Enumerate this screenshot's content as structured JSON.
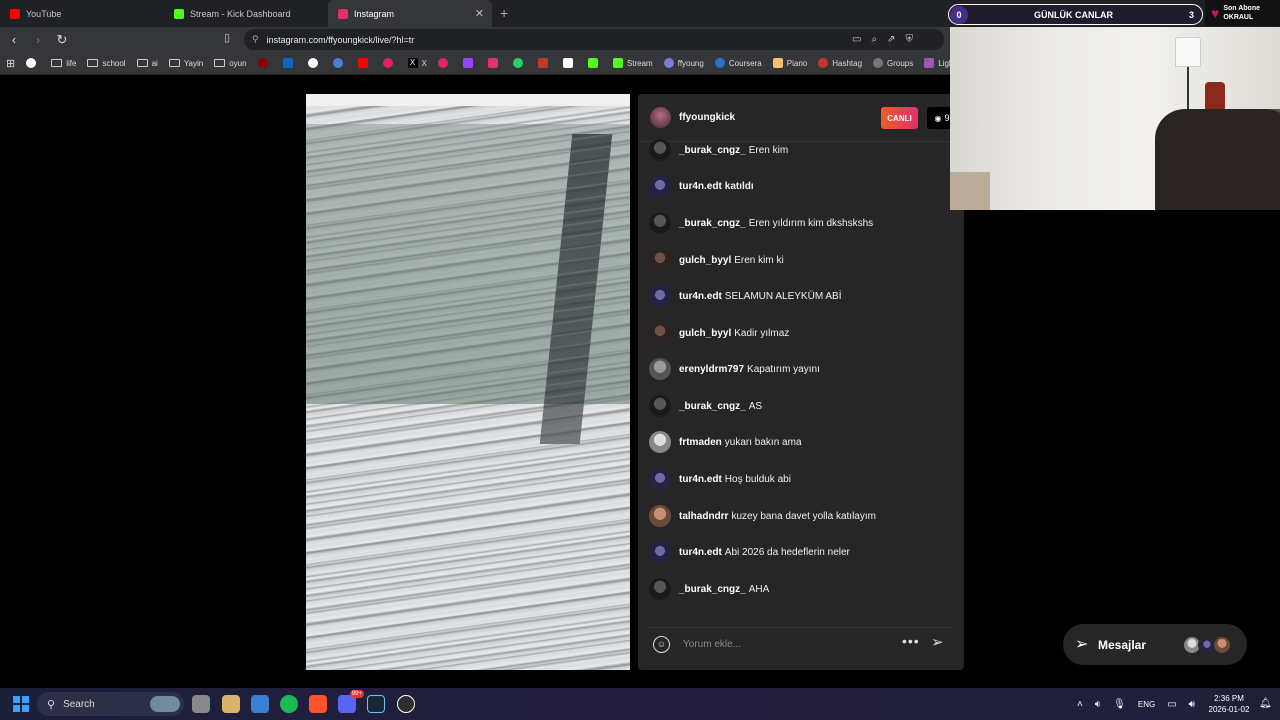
{
  "browser": {
    "tabs": [
      {
        "label": "YouTube",
        "color": "#ff0000"
      },
      {
        "label": "Stream - Kick Dashboard",
        "color": "#53fc18"
      },
      {
        "label": "Instagram",
        "color": "#e1306c"
      }
    ],
    "new_tab_glyph": "+",
    "url": "instagram.com/ffyoungkick/live/?hl=tr",
    "bookmarks": [
      {
        "label": "",
        "icon": "google-icon"
      },
      {
        "label": "life",
        "icon": "folder-icon"
      },
      {
        "label": "school",
        "icon": "folder-icon"
      },
      {
        "label": "ai",
        "icon": "folder-icon"
      },
      {
        "label": "Yayin",
        "icon": "folder-icon"
      },
      {
        "label": "oyun",
        "icon": "folder-icon"
      },
      {
        "label": "X",
        "icon": "x-icon"
      },
      {
        "label": "Stream",
        "icon": "kick-icon"
      },
      {
        "label": "ffyoung",
        "icon": "link-icon"
      },
      {
        "label": "Coursera",
        "icon": "coursera-icon"
      },
      {
        "label": "Piano",
        "icon": "piano-icon"
      },
      {
        "label": "Hashtag",
        "icon": "hashtag-icon"
      },
      {
        "label": "Groups",
        "icon": "groups-icon"
      },
      {
        "label": "Lightshot",
        "icon": "lightshot-icon"
      }
    ]
  },
  "live": {
    "host": "ffyoungkick",
    "live_label": "CANLI",
    "viewer_count": "9",
    "comments": [
      {
        "user": "_burak_cngz_",
        "text": "Eren kim",
        "avatar": "dark"
      },
      {
        "user": "tur4n.edt",
        "text": "katıldı",
        "avatar": "blue"
      },
      {
        "user": "_burak_cngz_",
        "text": "Eren yıldırım kim dkshskshs",
        "avatar": "dark"
      },
      {
        "user": "gulch_byyl",
        "text": "Eren kim ki",
        "avatar": "girl"
      },
      {
        "user": "tur4n.edt",
        "text": "SELAMUN ALEYKÜM ABİ",
        "avatar": "blue"
      },
      {
        "user": "gulch_byyl",
        "text": "Kadir yılmaz",
        "avatar": "girl"
      },
      {
        "user": "erenyldrm797",
        "text": "Kapatırım yayını",
        "avatar": "gray"
      },
      {
        "user": "_burak_cngz_",
        "text": "AS",
        "avatar": "dark"
      },
      {
        "user": "frtmaden",
        "text": "yukarı bakın ama",
        "avatar": "light"
      },
      {
        "user": "tur4n.edt",
        "text": "Hoş bulduk abi",
        "avatar": "blue"
      },
      {
        "user": "talhadndrr",
        "text": "kuzey bana davet yolla katılayım",
        "avatar": "face"
      },
      {
        "user": "tur4n.edt",
        "text": "Abi 2026 da hedeflerin neler",
        "avatar": "blue"
      },
      {
        "user": "_burak_cngz_",
        "text": "AHA",
        "avatar": "dark"
      }
    ],
    "comment_placeholder": "Yorum ekle...",
    "messages_label": "Mesajlar"
  },
  "overlay": {
    "left_count": "0",
    "title": "GÜNLÜK CANLAR",
    "right_count": "3",
    "sub_line1": "Son Abone",
    "sub_line2": "OKRAUL"
  },
  "taskbar": {
    "search_label": "Search",
    "badge": "99+",
    "language": "ENG",
    "time": "2:36 PM",
    "date": "2026-01-02"
  },
  "colors": {
    "instagram_panel": "#262626",
    "live_badge": "#e1306c",
    "taskbar": "#1b1f3a"
  }
}
